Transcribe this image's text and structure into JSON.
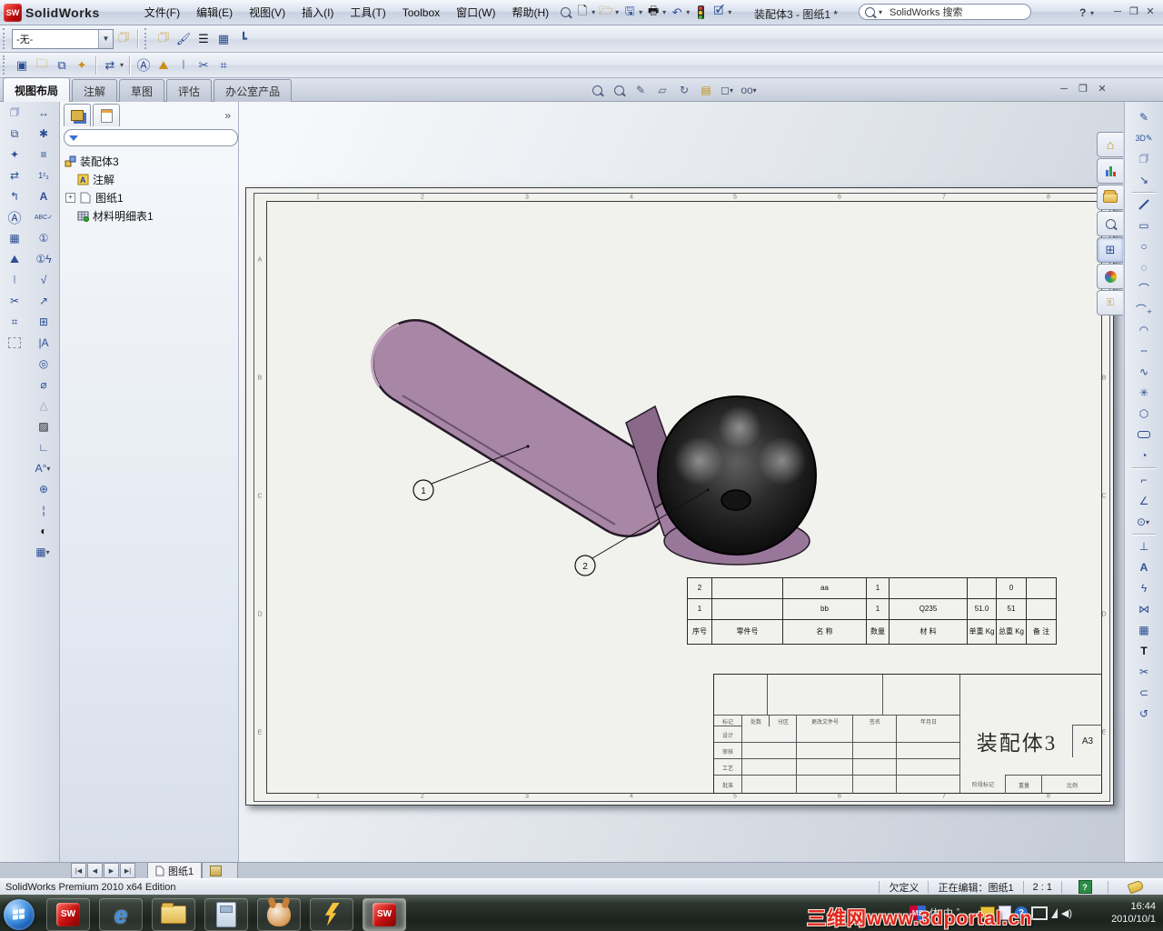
{
  "titlebar": {
    "app_name": "SolidWorks",
    "menus": [
      "文件(F)",
      "编辑(E)",
      "视图(V)",
      "插入(I)",
      "工具(T)",
      "Toolbox",
      "窗口(W)",
      "帮助(H)"
    ],
    "doc_title": "装配体3 - 图纸1 *",
    "search_value": "SolidWorks 搜索",
    "help_glyph": "?"
  },
  "line_format_bar": {
    "layer_value": "-无-"
  },
  "command_tabs": {
    "items": [
      "视图布局",
      "注解",
      "草图",
      "评估",
      "办公室产品"
    ],
    "active": "视图布局"
  },
  "feature_tree": {
    "root": "装配体3",
    "items": [
      "注解",
      "图纸1",
      "材料明细表1"
    ],
    "expand_glyph": "»"
  },
  "sheet": {
    "zone_numbers": [
      "1",
      "2",
      "3",
      "4",
      "5",
      "6",
      "7",
      "8"
    ],
    "zone_letters": [
      "A",
      "B",
      "C",
      "D",
      "E"
    ],
    "balloons": [
      "1",
      "2"
    ]
  },
  "bom": {
    "rows": [
      [
        "2",
        "",
        "aa",
        "1",
        "",
        "",
        "0",
        ""
      ],
      [
        "1",
        "",
        "bb",
        "1",
        "Q235",
        "51.0",
        "51",
        ""
      ]
    ],
    "headers": [
      "序号",
      "零件号",
      "名  称",
      "数量",
      "材  料",
      "单重 Kg",
      "总重 Kg",
      "备 注"
    ]
  },
  "title_block": {
    "title": "装配体3",
    "paper_size": "A3",
    "rev_cols": [
      "标记",
      "处数",
      "分区",
      "更改文件号",
      "签名",
      "年月日"
    ],
    "sign_rows": [
      "设计",
      "审核",
      "工艺",
      "批准"
    ],
    "stage_label": "阶段标记",
    "weight_label": "重量",
    "scale_label": "比例"
  },
  "sheet_tabs": {
    "active": "图纸1"
  },
  "statusbar": {
    "edition": "SolidWorks Premium 2010 x64 Edition",
    "definition": "欠定义",
    "editing": "正在编辑：图纸1",
    "scale": "2 : 1",
    "help_glyph": "?"
  },
  "taskbar": {
    "ime_1": "体",
    "ime_2": "中",
    "ime_3": "゜，",
    "ime_logo": "MS",
    "clock_time": "16:44",
    "clock_date": "2010/10/1",
    "watermark": "三维网www.3dportal.cn"
  }
}
